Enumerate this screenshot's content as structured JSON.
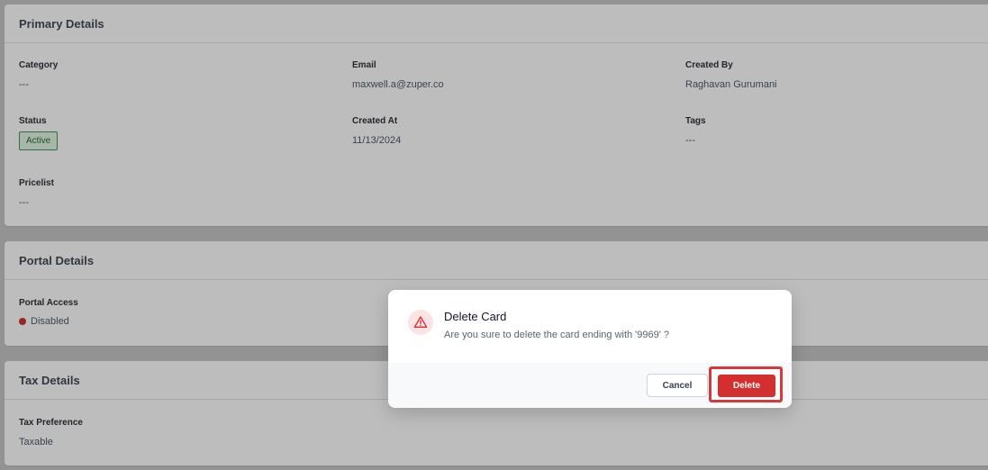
{
  "primary_details": {
    "title": "Primary Details",
    "category": {
      "label": "Category",
      "value": "---"
    },
    "email": {
      "label": "Email",
      "value": "maxwell.a@zuper.co"
    },
    "created_by": {
      "label": "Created By",
      "value": "Raghavan Gurumani"
    },
    "status": {
      "label": "Status",
      "value": "Active"
    },
    "created_at": {
      "label": "Created At",
      "value": "11/13/2024"
    },
    "tags": {
      "label": "Tags",
      "value": "---"
    },
    "pricelist": {
      "label": "Pricelist",
      "value": "---"
    }
  },
  "portal_details": {
    "title": "Portal Details",
    "portal_access": {
      "label": "Portal Access",
      "value": "Disabled"
    }
  },
  "tax_details": {
    "title": "Tax Details",
    "tax_preference": {
      "label": "Tax Preference",
      "value": "Taxable"
    }
  },
  "modal": {
    "title": "Delete Card",
    "message": "Are you sure to delete the card ending with '9969' ?",
    "icon": "warning-triangle-icon",
    "cancel_label": "Cancel",
    "delete_label": "Delete"
  },
  "colors": {
    "danger": "#d32f2f",
    "active_badge_bg": "#d7ead9",
    "active_badge_border": "#3f8f52",
    "disabled_dot": "#c53030"
  }
}
